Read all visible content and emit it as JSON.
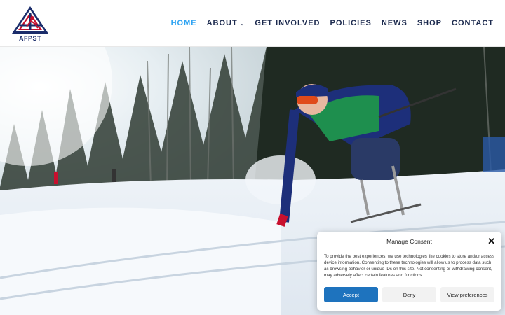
{
  "logo": {
    "text": "AFPST"
  },
  "nav": {
    "items": [
      {
        "label": "HOME",
        "active": true
      },
      {
        "label": "ABOUT",
        "dropdown": true
      },
      {
        "label": "GET INVOLVED"
      },
      {
        "label": "POLICIES"
      },
      {
        "label": "NEWS"
      },
      {
        "label": "SHOP"
      },
      {
        "label": "CONTACT"
      }
    ],
    "active_color": "#2ea3f2",
    "color": "#1c2a4e"
  },
  "consent": {
    "title": "Manage Consent",
    "body": "To provide the best experiences, we use technologies like cookies to store and/or access device information. Consenting to these technologies will allow us to process data such as browsing behavior or unique IDs on this site. Not consenting or withdrawing consent, may adversely affect certain features and functions.",
    "accept_label": "Accept",
    "deny_label": "Deny",
    "prefs_label": "View preferences",
    "accept_color": "#1e73be"
  }
}
